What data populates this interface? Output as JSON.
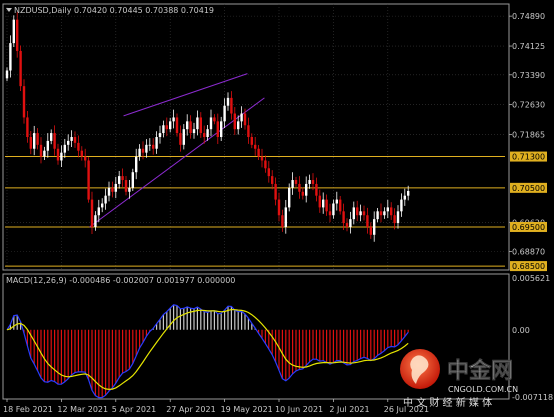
{
  "symbol_header": "NZDUSD,Daily  0.70420 0.70445 0.70388 0.70419",
  "macd_header": "MACD(12,26,9) -0.000486 -0.002007 0.001977 0.000000",
  "watermark": {
    "brand_cn": "中金网",
    "brand_domain": "CNGOLD.COM.CN",
    "tagline": "中 文 财 经 新 媒 体"
  },
  "colors": {
    "background": "#000000",
    "frame": "#9a9a9a",
    "grid": "#3a3a3a",
    "bull_candle": "#ffffff",
    "bear_candle": "#e01010",
    "hline": "#e0b020",
    "channel": "#8c2bd0",
    "macd_line": "#2a3cff",
    "signal_line": "#e6e600",
    "hist_pos": "#c8c8c8",
    "hist_neg": "#e01010",
    "text": "#c8c8c8"
  },
  "chart_data": [
    {
      "type": "candlestick",
      "symbol": "NZDUSD",
      "timeframe": "Daily",
      "ylim": [
        0.684,
        0.752
      ],
      "y_ticks": [
        "0.74890",
        "0.74125",
        "0.73390",
        "0.72630",
        "0.71865",
        "0.69620",
        "0.68870"
      ],
      "x_tick_labels": [
        "18 Feb 2021",
        "12 Mar 2021",
        "5 Apr 2021",
        "27 Apr 2021",
        "19 May 2021",
        "10 Jun 2021",
        "2 Jul 2021",
        "26 Jul 2021"
      ],
      "horizontal_levels": [
        {
          "label": "0.71300",
          "value": 0.713
        },
        {
          "label": "0.70500",
          "value": 0.705
        },
        {
          "label": "0.69500",
          "value": 0.695
        },
        {
          "label": "0.68500",
          "value": 0.685
        }
      ],
      "trendlines": [
        {
          "name": "channel-upper",
          "points": [
            [
              "2021-04-01",
              0.7234
            ],
            [
              "2021-05-22",
              0.7342
            ]
          ]
        },
        {
          "name": "channel-lower",
          "points": [
            [
              "2021-03-18",
              0.695
            ],
            [
              "2021-05-29",
              0.728
            ]
          ]
        }
      ],
      "close": [
        0.735,
        0.742,
        0.748,
        0.74,
        0.731,
        0.723,
        0.718,
        0.715,
        0.719,
        0.716,
        0.713,
        0.7145,
        0.717,
        0.719,
        0.715,
        0.712,
        0.714,
        0.716,
        0.717,
        0.718,
        0.7165,
        0.7145,
        0.713,
        0.712,
        0.702,
        0.695,
        0.698,
        0.7,
        0.701,
        0.703,
        0.705,
        0.704,
        0.706,
        0.708,
        0.707,
        0.704,
        0.705,
        0.709,
        0.713,
        0.715,
        0.714,
        0.716,
        0.716,
        0.715,
        0.718,
        0.719,
        0.721,
        0.72,
        0.722,
        0.723,
        0.719,
        0.716,
        0.72,
        0.722,
        0.719,
        0.72,
        0.723,
        0.719,
        0.718,
        0.72,
        0.723,
        0.722,
        0.718,
        0.722,
        0.726,
        0.728,
        0.724,
        0.72,
        0.722,
        0.724,
        0.721,
        0.718,
        0.716,
        0.715,
        0.713,
        0.712,
        0.71,
        0.708,
        0.706,
        0.702,
        0.698,
        0.695,
        0.7,
        0.705,
        0.707,
        0.706,
        0.704,
        0.703,
        0.706,
        0.707,
        0.706,
        0.703,
        0.7,
        0.702,
        0.699,
        0.698,
        0.701,
        0.702,
        0.699,
        0.696,
        0.695,
        0.697,
        0.7,
        0.698,
        0.699,
        0.698,
        0.695,
        0.693,
        0.697,
        0.699,
        0.698,
        0.699,
        0.7,
        0.698,
        0.696,
        0.699,
        0.702,
        0.703,
        0.7042
      ]
    },
    {
      "type": "macd",
      "params": "12,26,9",
      "ylim": [
        -0.0072,
        0.0058
      ],
      "y_ticks": [
        "0.005621",
        "0.00",
        "-0.007118"
      ],
      "x_tick_labels": [
        "18 Feb 2021",
        "12 Mar 2021",
        "5 Apr 2021",
        "27 Apr 2021",
        "19 May 2021",
        "10 Jun 2021",
        "2 Jul 2021",
        "26 Jul 2021"
      ]
    }
  ]
}
